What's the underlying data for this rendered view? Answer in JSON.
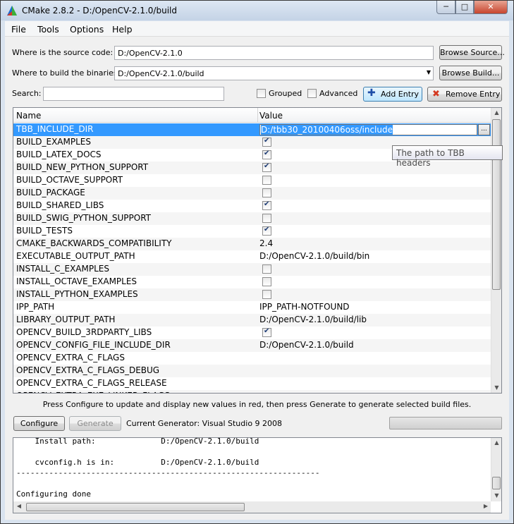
{
  "window": {
    "title": "CMake 2.8.2 - D:/OpenCV-2.1.0/build",
    "icon": "cmake-triangle-icon"
  },
  "menu": [
    "File",
    "Tools",
    "Options",
    "Help"
  ],
  "source": {
    "label": "Where is the source code:",
    "value": "D:/OpenCV-2.1.0",
    "button": "Browse Source..."
  },
  "binaries": {
    "label": "Where to build the binaries:",
    "value": "D:/OpenCV-2.1.0/build",
    "button": "Browse Build..."
  },
  "search": {
    "label": "Search:",
    "value": ""
  },
  "options": {
    "grouped": "Grouped",
    "grouped_checked": false,
    "advanced": "Advanced",
    "advanced_checked": false,
    "add_entry": "Add Entry",
    "remove_entry": "Remove Entry"
  },
  "table": {
    "headers": [
      "Name",
      "Value"
    ],
    "selected": {
      "name": "TBB_INCLUDE_DIR",
      "value": "D:/tbb30_20100406oss/include",
      "browse": "..."
    },
    "rows": [
      {
        "name": "BUILD_EXAMPLES",
        "check": true
      },
      {
        "name": "BUILD_LATEX_DOCS",
        "check": true
      },
      {
        "name": "BUILD_NEW_PYTHON_SUPPORT",
        "check": true
      },
      {
        "name": "BUILD_OCTAVE_SUPPORT",
        "check": false
      },
      {
        "name": "BUILD_PACKAGE",
        "check": false
      },
      {
        "name": "BUILD_SHARED_LIBS",
        "check": true
      },
      {
        "name": "BUILD_SWIG_PYTHON_SUPPORT",
        "check": false
      },
      {
        "name": "BUILD_TESTS",
        "check": true
      },
      {
        "name": "CMAKE_BACKWARDS_COMPATIBILITY",
        "value": "2.4"
      },
      {
        "name": "EXECUTABLE_OUTPUT_PATH",
        "value": "D:/OpenCV-2.1.0/build/bin"
      },
      {
        "name": "INSTALL_C_EXAMPLES",
        "check": false
      },
      {
        "name": "INSTALL_OCTAVE_EXAMPLES",
        "check": false
      },
      {
        "name": "INSTALL_PYTHON_EXAMPLES",
        "check": false
      },
      {
        "name": "IPP_PATH",
        "value": "IPP_PATH-NOTFOUND"
      },
      {
        "name": "LIBRARY_OUTPUT_PATH",
        "value": "D:/OpenCV-2.1.0/build/lib"
      },
      {
        "name": "OPENCV_BUILD_3RDPARTY_LIBS",
        "check": true
      },
      {
        "name": "OPENCV_CONFIG_FILE_INCLUDE_DIR",
        "value": "D:/OpenCV-2.1.0/build"
      },
      {
        "name": "OPENCV_EXTRA_C_FLAGS",
        "value": ""
      },
      {
        "name": "OPENCV_EXTRA_C_FLAGS_DEBUG",
        "value": ""
      },
      {
        "name": "OPENCV_EXTRA_C_FLAGS_RELEASE",
        "value": ""
      },
      {
        "name": "OPENCV_EXTRA_EXE_LINKER_FLAGS",
        "value": ""
      }
    ]
  },
  "tooltip": "The path to TBB headers",
  "hint": "Press Configure to update and display new values in red, then press Generate to generate selected build files.",
  "actions": {
    "configure": "Configure",
    "generate": "Generate",
    "generator": "Current Generator: Visual Studio 9 2008"
  },
  "output": [
    "    Install path:              D:/OpenCV-2.1.0/build",
    "",
    "    cvconfig.h is in:          D:/OpenCV-2.1.0/build",
    "-----------------------------------------------------------------",
    "",
    "Configuring done"
  ]
}
